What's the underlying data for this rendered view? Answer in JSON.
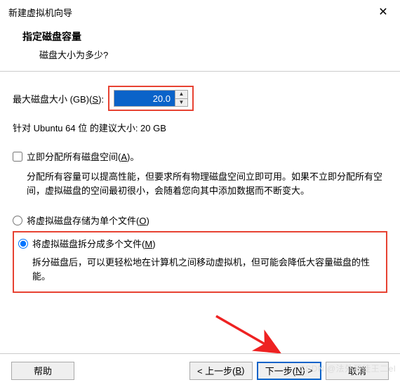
{
  "window": {
    "title": "新建虚拟机向导"
  },
  "header": {
    "title": "指定磁盘容量",
    "subtitle": "磁盘大小为多少?"
  },
  "disk": {
    "max_label_pre": "最大磁盘大小 (GB)(",
    "max_hotkey": "S",
    "max_label_post": "):",
    "value": "20.0",
    "recommend": "针对 Ubuntu 64 位 的建议大小: 20 GB"
  },
  "allocate": {
    "label_pre": "立即分配所有磁盘空间(",
    "hotkey": "A",
    "label_post": ")。",
    "desc": "分配所有容量可以提高性能，但要求所有物理磁盘空间立即可用。如果不立即分配所有空间，虚拟磁盘的空间最初很小，会随着您向其中添加数据而不断变大。"
  },
  "store_single": {
    "label_pre": "将虚拟磁盘存储为单个文件(",
    "hotkey": "O",
    "label_post": ")"
  },
  "store_split": {
    "label_pre": "将虚拟磁盘拆分成多个文件(",
    "hotkey": "M",
    "label_post": ")",
    "desc": "拆分磁盘后，可以更轻松地在计算机之间移动虚拟机，但可能会降低大容量磁盘的性能。"
  },
  "buttons": {
    "help": "帮助",
    "back_pre": "< 上一步(",
    "back_hot": "B",
    "back_post": ")",
    "next_pre": "下一步(",
    "next_hot": "N",
    "next_post": ") >",
    "cancel": "取消"
  },
  "watermark": "CSDN @法外狂徒王二el"
}
